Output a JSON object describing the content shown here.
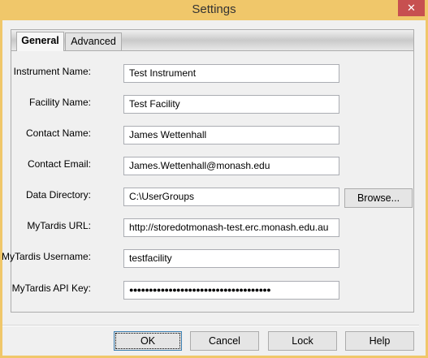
{
  "window": {
    "title": "Settings",
    "close_glyph": "✕"
  },
  "tabs": [
    {
      "label": "General",
      "active": true
    },
    {
      "label": "Advanced",
      "active": false
    }
  ],
  "fields": [
    {
      "label": "Instrument Name:",
      "value": "Test Instrument"
    },
    {
      "label": "Facility Name:",
      "value": "Test Facility"
    },
    {
      "label": "Contact Name:",
      "value": "James Wettenhall"
    },
    {
      "label": "Contact Email:",
      "value": "James.Wettenhall@monash.edu"
    },
    {
      "label": "Data Directory:",
      "value": "C:\\UserGroups"
    },
    {
      "label": "MyTardis URL:",
      "value": "http://storedotmonash-test.erc.monash.edu.au"
    },
    {
      "label": "MyTardis Username:",
      "value": "testfacility"
    },
    {
      "label": "MyTardis API Key:",
      "value": "●●●●●●●●●●●●●●●●●●●●●●●●●●●●●●●●●●●●"
    }
  ],
  "browse_label": "Browse...",
  "buttons": {
    "ok": "OK",
    "cancel": "Cancel",
    "lock": "Lock",
    "help": "Help"
  }
}
